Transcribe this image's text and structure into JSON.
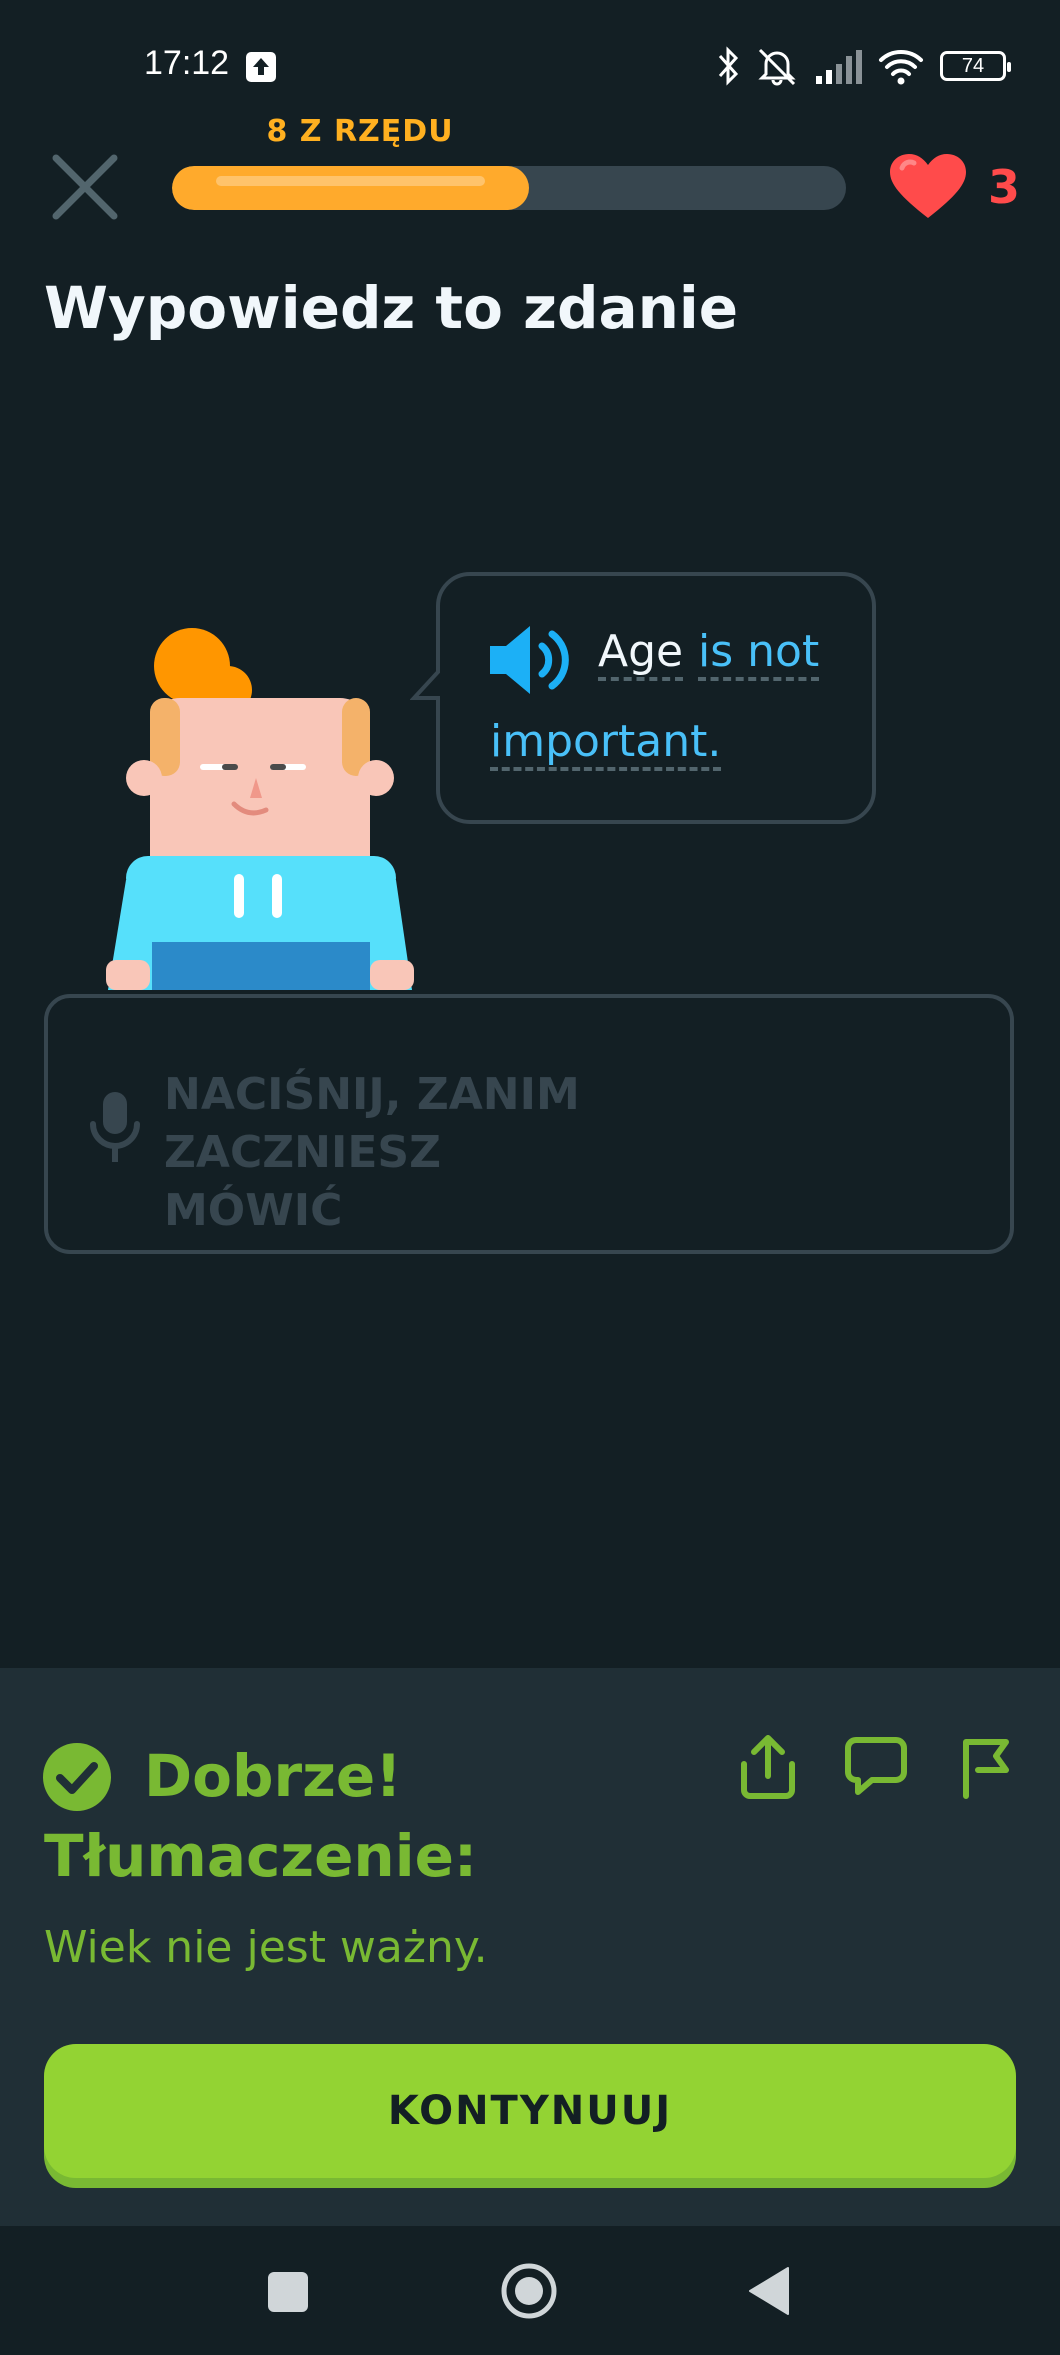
{
  "status_bar": {
    "time": "17:12",
    "battery": "74",
    "icons": [
      "upload-icon",
      "bluetooth-icon",
      "mute-icon",
      "signal-icon",
      "wifi-icon",
      "battery-icon"
    ]
  },
  "header": {
    "streak_label": "8 Z RZĘDU",
    "progress": 0.53,
    "hearts": "3"
  },
  "title": "Wypowiedz to zdanie",
  "bubble": {
    "words": [
      "Age",
      "is not",
      "important."
    ]
  },
  "mic": {
    "line1": "NACIŚNIJ, ZANIM ZACZNIESZ",
    "line2": "MÓWIĆ"
  },
  "feedback": {
    "status": "Dobrze!",
    "translation_label": "Tłumaczenie:",
    "translation": "Wiek nie jest ważny.",
    "continue_label": "KONTYNUUJ"
  },
  "colors": {
    "background": "#131f24",
    "panel": "#202f36",
    "accent_green": "#93d333",
    "text_green": "#79b933",
    "progress": "#ffaa2c",
    "heart": "#ff4b4b",
    "link_blue": "#49c0f8"
  }
}
